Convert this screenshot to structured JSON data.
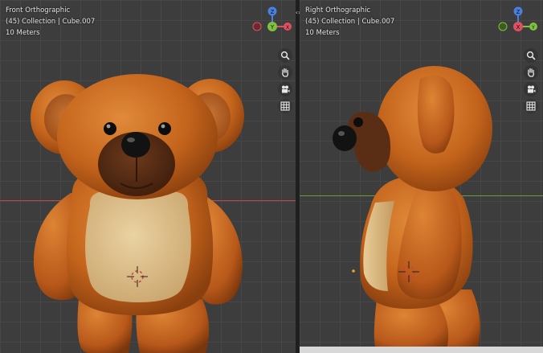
{
  "viewports": [
    {
      "view_name": "Front Orthographic",
      "collection": "(45) Collection | Cube.007",
      "scale": "10 Meters",
      "horizon_axis_color": "#b94a4a",
      "gizmo": {
        "top": "Z",
        "center": "Y",
        "left": "X",
        "right": "X"
      }
    },
    {
      "view_name": "Right Orthographic",
      "collection": "(45) Collection | Cube.007",
      "scale": "10 Meters",
      "horizon_axis_color": "#6f9a3a",
      "gizmo": {
        "top": "Z",
        "center": "X",
        "left": "Y",
        "right": "Y"
      }
    }
  ],
  "tools": [
    "zoom-icon",
    "hand-pan-icon",
    "camera-icon",
    "grid-icon"
  ],
  "colors": {
    "bear_fur": "#c4641c",
    "bear_fur_dark": "#8a3f0e",
    "belly": "#dcc08e",
    "muzzle": "#5a2e14",
    "nose": "#111111",
    "axis_x": "#e05060",
    "axis_y": "#80c040",
    "axis_z": "#4a80e0"
  }
}
